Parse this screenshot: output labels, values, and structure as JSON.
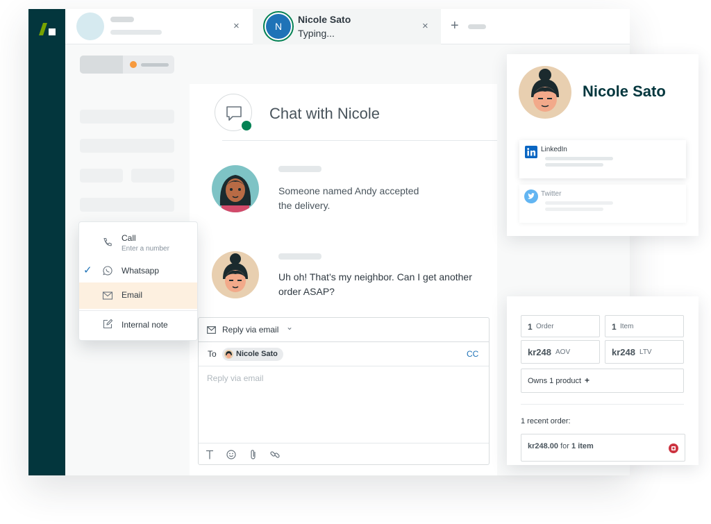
{
  "tabs": [
    {
      "name": "",
      "status": ""
    },
    {
      "name": "Nicole Sato",
      "status": "Typing...",
      "avatar_letter": "N"
    }
  ],
  "icons": {
    "close": "×",
    "add_tab": "+",
    "chevron_down": "⌄",
    "check": "✓",
    "add_product": "+"
  },
  "colors": {
    "rail": "#03363d",
    "online": "#038153",
    "accent_blue": "#1f73b7",
    "menu_highlight": "#fdf0e0",
    "status_dot": "#f79a3e"
  },
  "chat": {
    "title": "Chat with Nicole",
    "messages": [
      {
        "line1": "Someone named Andy accepted",
        "line2": "the delivery."
      },
      {
        "line1": "Uh oh! That’s my neighbor. Can I get another",
        "line2": "order ASAP?"
      }
    ]
  },
  "composer": {
    "reply_mode": "Reply via email",
    "to_label": "To",
    "recipient": "Nicole Sato",
    "cc_label": "CC",
    "placeholder": "Reply via email"
  },
  "channel_menu": {
    "items": [
      {
        "label": "Call",
        "sublabel": "Enter a number",
        "icon": "phone-icon",
        "checked": false,
        "highlighted": false
      },
      {
        "label": "Whatsapp",
        "icon": "whatsapp-icon",
        "checked": true,
        "highlighted": false
      },
      {
        "label": "Email",
        "icon": "mail-icon",
        "checked": false,
        "highlighted": true
      },
      {
        "label": "Internal note",
        "icon": "note-icon",
        "checked": false,
        "highlighted": false
      }
    ]
  },
  "profile": {
    "name": "Nicole Sato",
    "linkedin_label": "LinkedIn",
    "twitter_label": "Twitter"
  },
  "orders": {
    "order_count": "1",
    "order_label": "Order",
    "item_count": "1",
    "item_label": "Item",
    "aov_value": "kr248",
    "aov_label": "AOV",
    "ltv_value": "kr248",
    "ltv_label": "LTV",
    "owns_label": "Owns 1 product",
    "recent_title": "1 recent order:",
    "recent_amount": "kr248.00",
    "recent_for": "for",
    "recent_items": "1 item"
  }
}
